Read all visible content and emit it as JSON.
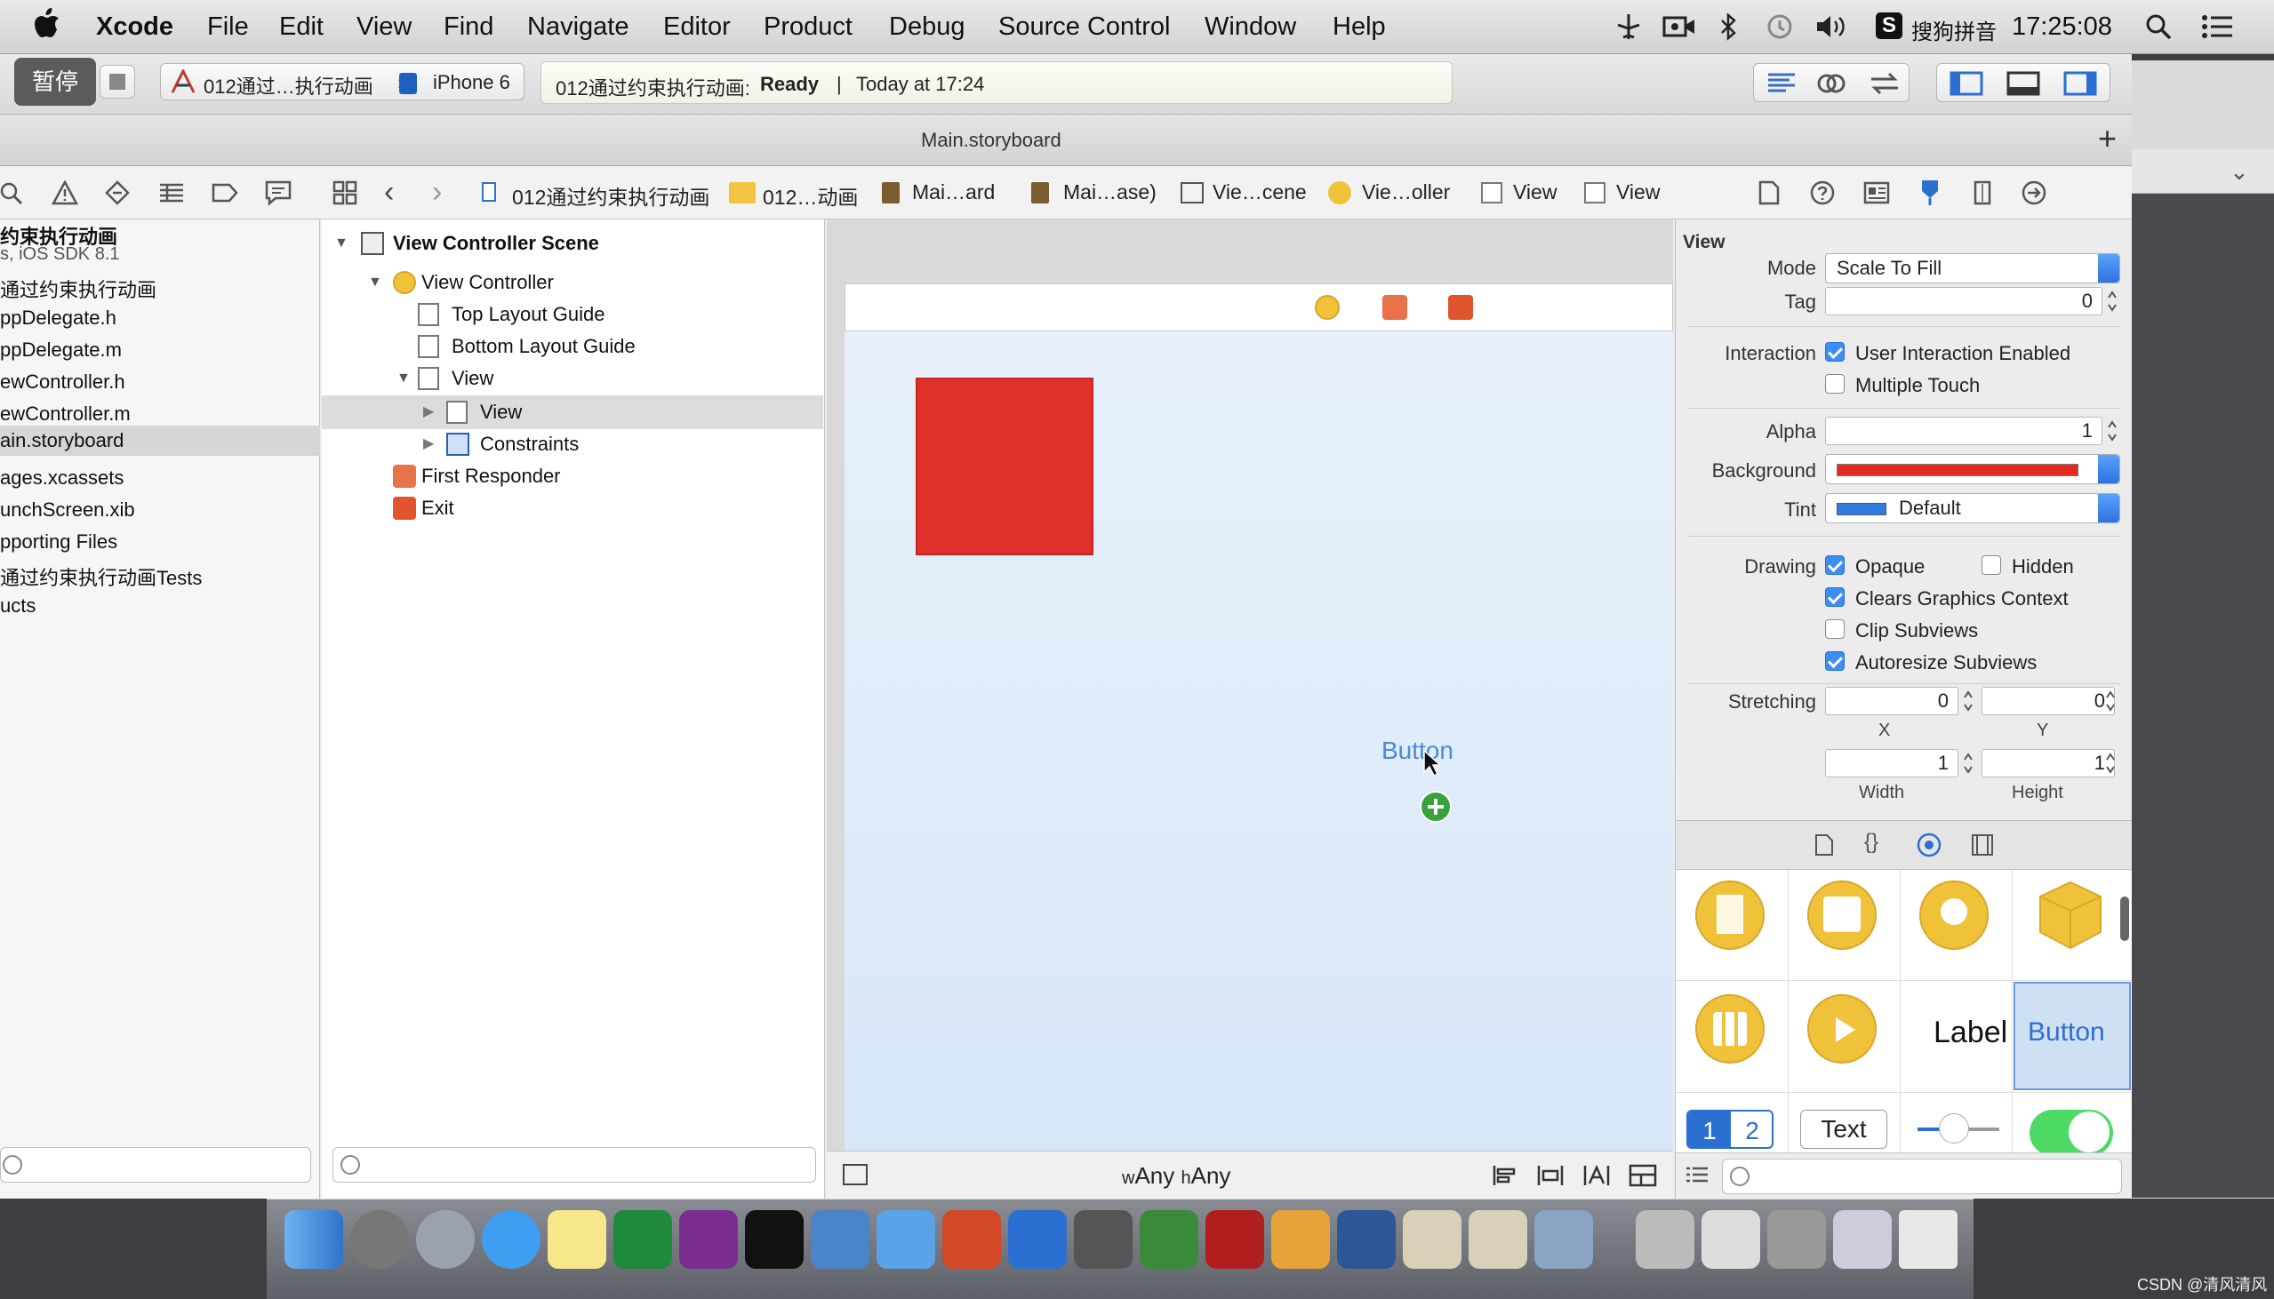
{
  "menubar": {
    "apple": "",
    "items": [
      "Xcode",
      "File",
      "Edit",
      "View",
      "Find",
      "Navigate",
      "Editor",
      "Product",
      "Debug",
      "Source Control",
      "Window",
      "Help"
    ],
    "input_method": "搜狗拼音",
    "clock": "17:25:08"
  },
  "toolbar": {
    "pause_label": "暂停",
    "scheme": "012通过…执行动画",
    "device": "iPhone 6",
    "status_project": "012通过约束执行动画:",
    "status_state": "Ready",
    "status_separator": "|",
    "status_time": "Today at 17:24"
  },
  "tabbar": {
    "title": "Main.storyboard",
    "add": "+"
  },
  "jumpbar": {
    "crumbs": [
      "012通过约束执行动画",
      "012…动画",
      "Mai…ard",
      "Mai…ase)",
      "Vie…cene",
      "Vie…oller",
      "View",
      "View"
    ]
  },
  "navigator": {
    "items": [
      "约束执行动画",
      "s, iOS SDK 8.1",
      "通过约束执行动画",
      "ppDelegate.h",
      "ppDelegate.m",
      "ewController.h",
      "ewController.m",
      "ain.storyboard",
      "ages.xcassets",
      "unchScreen.xib",
      "pporting Files",
      "通过约束执行动画Tests",
      "ucts"
    ],
    "selected_index": 7
  },
  "outline": {
    "scene": "View Controller Scene",
    "view_controller": "View Controller",
    "top_guide": "Top Layout Guide",
    "bottom_guide": "Bottom Layout Guide",
    "view": "View",
    "subview": "View",
    "constraints": "Constraints",
    "first_responder": "First Responder",
    "exit": "Exit"
  },
  "canvas": {
    "button_text": "Button",
    "size_w_prefix": "w",
    "size_w": "Any",
    "size_h_prefix": "h",
    "size_h": "Any",
    "red_view_color": "#e0302a"
  },
  "inspector": {
    "section": "View",
    "mode_label": "Mode",
    "mode_value": "Scale To Fill",
    "tag_label": "Tag",
    "tag_value": "0",
    "interaction_label": "Interaction",
    "user_interaction": "User Interaction Enabled",
    "multiple_touch": "Multiple Touch",
    "alpha_label": "Alpha",
    "alpha_value": "1",
    "background_label": "Background",
    "background_color": "#e5291f",
    "tint_label": "Tint",
    "tint_value": "Default",
    "tint_color": "#2f7de1",
    "drawing_label": "Drawing",
    "opaque": "Opaque",
    "hidden": "Hidden",
    "clears": "Clears Graphics Context",
    "clip": "Clip Subviews",
    "autoresize": "Autoresize Subviews",
    "stretching_label": "Stretching",
    "stretch_x": "0",
    "stretch_y": "0",
    "x_caption": "X",
    "y_caption": "Y",
    "stretch_w": "1",
    "stretch_h": "1",
    "width_caption": "Width",
    "height_caption": "Height"
  },
  "library": {
    "label_text": "Label",
    "button_text": "Button",
    "seg_1": "1",
    "seg_2": "2",
    "text_field": "Text"
  },
  "watermark": "CSDN @清风清风"
}
